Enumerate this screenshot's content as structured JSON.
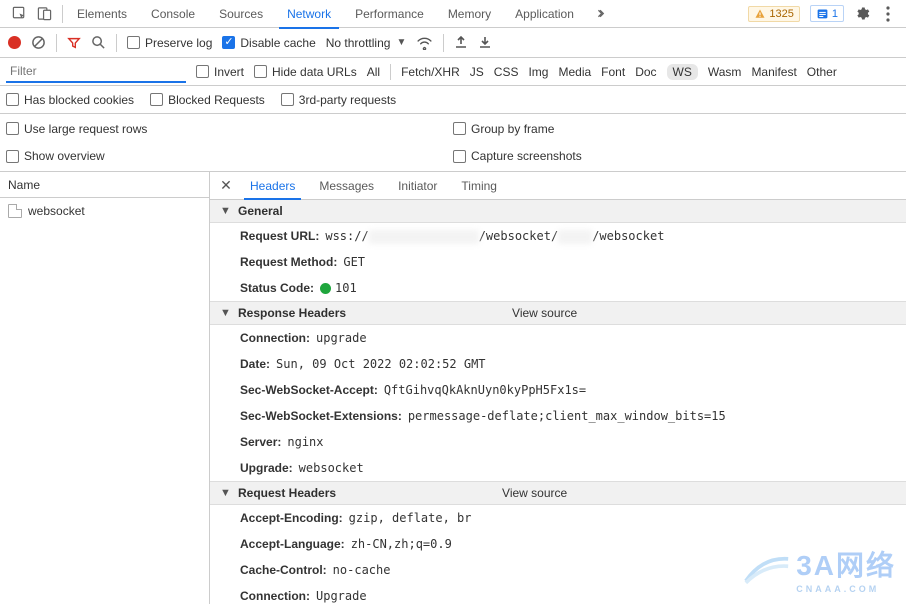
{
  "top": {
    "tabs": [
      "Elements",
      "Console",
      "Sources",
      "Network",
      "Performance",
      "Memory",
      "Application"
    ],
    "active_tab": "Network",
    "warning_count": "1325",
    "info_count": "1"
  },
  "netbar": {
    "preserve_log": "Preserve log",
    "disable_cache": "Disable cache",
    "throttling": "No throttling"
  },
  "filter": {
    "placeholder": "Filter",
    "invert": "Invert",
    "hide_data_urls": "Hide data URLs",
    "types": [
      "All",
      "Fetch/XHR",
      "JS",
      "CSS",
      "Img",
      "Media",
      "Font",
      "Doc",
      "WS",
      "Wasm",
      "Manifest",
      "Other"
    ],
    "selected_type": "WS"
  },
  "row3": {
    "blocked_cookies": "Has blocked cookies",
    "blocked_requests": "Blocked Requests",
    "third_party": "3rd-party requests"
  },
  "opts": {
    "large_rows": "Use large request rows",
    "group_by_frame": "Group by frame",
    "show_overview": "Show overview",
    "capture_screenshots": "Capture screenshots"
  },
  "reqlist": {
    "header": "Name",
    "rows": [
      "websocket"
    ]
  },
  "details": {
    "tabs": [
      "Headers",
      "Messages",
      "Initiator",
      "Timing"
    ],
    "active_tab": "Headers",
    "general_label": "General",
    "general": {
      "request_url_k": "Request URL:",
      "request_url_pre": "wss://",
      "request_url_mid": "/websocket/",
      "request_url_post": "/websocket",
      "request_method_k": "Request Method:",
      "request_method_v": "GET",
      "status_code_k": "Status Code:",
      "status_code_v": "101"
    },
    "view_source": "View source",
    "response_headers_label": "Response Headers",
    "response_headers": [
      {
        "k": "Connection:",
        "v": "upgrade"
      },
      {
        "k": "Date:",
        "v": "Sun, 09 Oct 2022 02:02:52 GMT"
      },
      {
        "k": "Sec-WebSocket-Accept:",
        "v": "QftGihvqQkAknUyn0kyPpH5Fx1s="
      },
      {
        "k": "Sec-WebSocket-Extensions:",
        "v": "permessage-deflate;client_max_window_bits=15"
      },
      {
        "k": "Server:",
        "v": "nginx"
      },
      {
        "k": "Upgrade:",
        "v": "websocket"
      }
    ],
    "request_headers_label": "Request Headers",
    "request_headers": [
      {
        "k": "Accept-Encoding:",
        "v": "gzip, deflate, br"
      },
      {
        "k": "Accept-Language:",
        "v": "zh-CN,zh;q=0.9"
      },
      {
        "k": "Cache-Control:",
        "v": "no-cache"
      },
      {
        "k": "Connection:",
        "v": "Upgrade"
      }
    ]
  },
  "watermark": {
    "big": "3A网络",
    "small": "CNAAA.COM"
  }
}
